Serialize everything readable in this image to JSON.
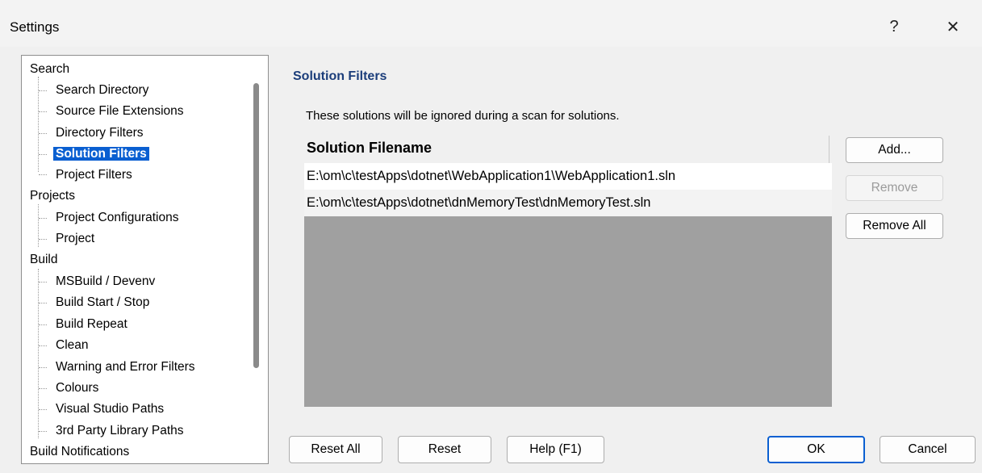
{
  "window": {
    "title": "Settings",
    "help_glyph": "?",
    "close_glyph": "✕"
  },
  "tree": {
    "groups": [
      {
        "label": "Search",
        "children": [
          "Search Directory",
          "Source File Extensions",
          "Directory Filters",
          "Solution Filters",
          "Project Filters"
        ]
      },
      {
        "label": "Projects",
        "children": [
          "Project Configurations",
          "Project"
        ]
      },
      {
        "label": "Build",
        "children": [
          "MSBuild / Devenv",
          "Build Start / Stop",
          "Build Repeat",
          "Clean",
          "Warning and Error Filters",
          "Colours",
          "Visual Studio Paths",
          "3rd Party Library Paths"
        ]
      },
      {
        "label": "Build Notifications",
        "children": []
      }
    ],
    "selected": "Solution Filters"
  },
  "panel": {
    "heading": "Solution Filters",
    "description": "These solutions will be ignored during a scan for solutions.",
    "column_header": "Solution Filename",
    "rows": [
      "E:\\om\\c\\testApps\\dotnet\\WebApplication1\\WebApplication1.sln",
      "E:\\om\\c\\testApps\\dotnet\\dnMemoryTest\\dnMemoryTest.sln"
    ],
    "buttons": {
      "add": "Add...",
      "remove": "Remove",
      "remove_all": "Remove All"
    }
  },
  "footer": {
    "reset_all": "Reset All",
    "reset": "Reset",
    "help": "Help (F1)",
    "ok": "OK",
    "cancel": "Cancel"
  },
  "colors": {
    "selection": "#0a5fd1",
    "heading": "#1b3d7a",
    "list_background": "#a0a0a0"
  }
}
